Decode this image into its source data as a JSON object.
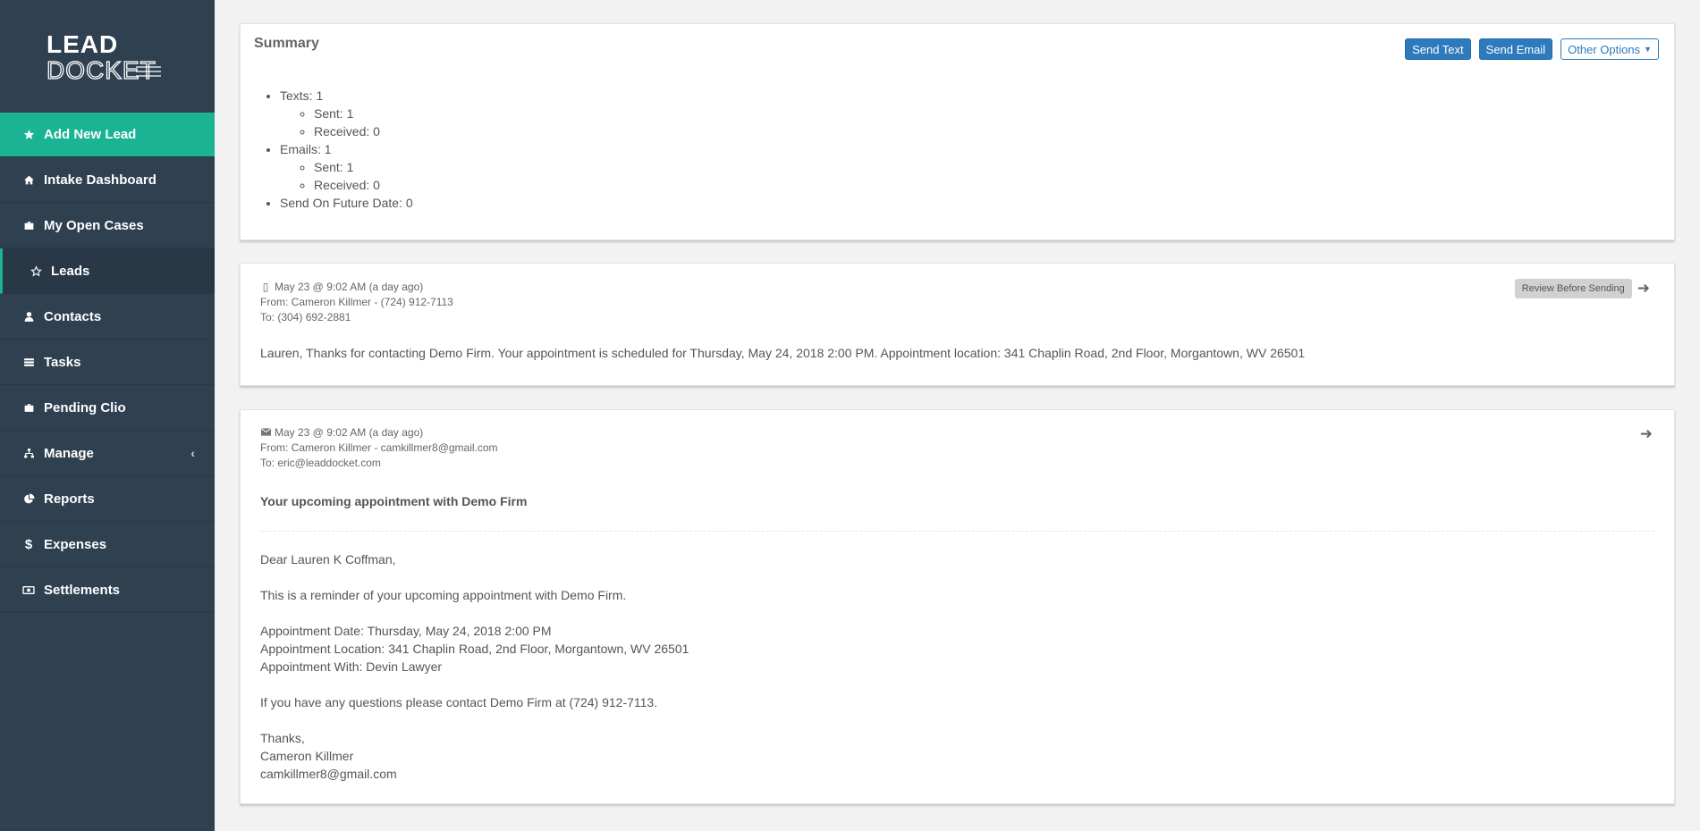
{
  "brand": {
    "line1": "LEAD",
    "line2": "DOCKET"
  },
  "sidebar": {
    "items": [
      {
        "label": "Add New Lead",
        "icon": "star-icon"
      },
      {
        "label": "Intake Dashboard",
        "icon": "home-icon"
      },
      {
        "label": "My Open Cases",
        "icon": "briefcase-icon"
      },
      {
        "label": "Leads",
        "icon": "star-outline-icon"
      },
      {
        "label": "Contacts",
        "icon": "user-icon"
      },
      {
        "label": "Tasks",
        "icon": "tasks-icon"
      },
      {
        "label": "Pending Clio",
        "icon": "briefcase-icon"
      },
      {
        "label": "Manage",
        "icon": "sitemap-icon",
        "caret": "‹"
      },
      {
        "label": "Reports",
        "icon": "pie-chart-icon"
      },
      {
        "label": "Expenses",
        "icon": "dollar-icon"
      },
      {
        "label": "Settlements",
        "icon": "money-icon"
      }
    ]
  },
  "summary": {
    "title": "Summary",
    "buttons": {
      "send_text": "Send Text",
      "send_email": "Send Email",
      "other_options": "Other Options"
    },
    "texts": "Texts: 1",
    "texts_sent": "Sent: 1",
    "texts_received": "Received: 0",
    "emails": "Emails: 1",
    "emails_sent": "Sent: 1",
    "emails_received": "Received: 0",
    "future": "Send On Future Date: 0"
  },
  "text_message": {
    "date": "May 23 @ 9:02 AM (a day ago)",
    "from": "From: Cameron Killmer - (724) 912-7113",
    "to": "To: (304) 692-2881",
    "badge": "Review Before Sending",
    "body": "Lauren, Thanks for contacting Demo Firm. Your appointment is scheduled for Thursday, May 24, 2018 2:00 PM. Appointment location: 341 Chaplin Road, 2nd Floor, Morgantown, WV 26501"
  },
  "email_message": {
    "date": "May 23 @ 9:02 AM (a day ago)",
    "from": "From: Cameron Killmer - camkillmer8@gmail.com",
    "to": "To: eric@leaddocket.com",
    "subject": "Your upcoming appointment with Demo Firm",
    "greeting": "Dear Lauren K Coffman,",
    "intro": "This is a reminder of your upcoming appointment with Demo Firm.",
    "appt_date": "Appointment Date: Thursday, May 24, 2018 2:00 PM",
    "appt_location": "Appointment Location: 341 Chaplin Road, 2nd Floor, Morgantown, WV 26501",
    "appt_with": "Appointment With: Devin Lawyer",
    "questions": "If you have any questions please contact Demo Firm at (724) 912-7113.",
    "signoff": "Thanks,",
    "sender_name": "Cameron Killmer",
    "sender_email": "camkillmer8@gmail.com"
  },
  "colors": {
    "sidebar_bg": "#2f4050",
    "accent": "#1ab394",
    "primary": "#2d7bbd"
  }
}
